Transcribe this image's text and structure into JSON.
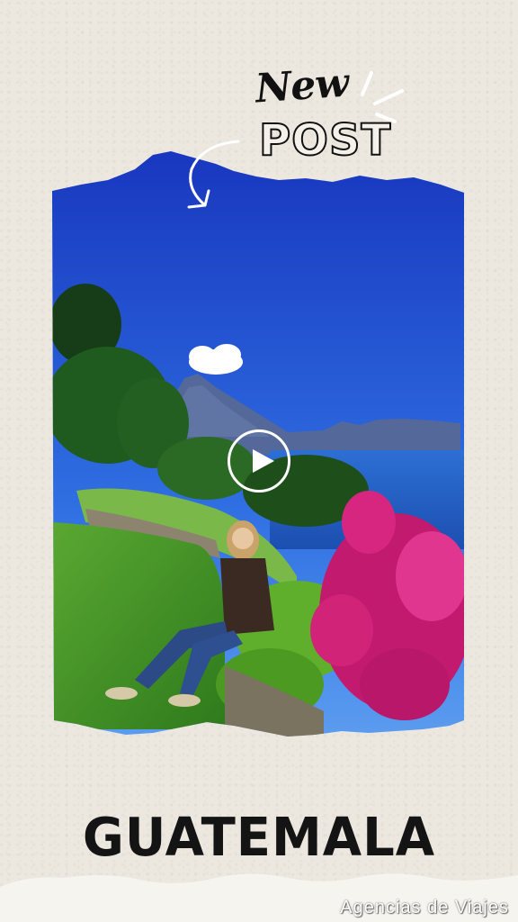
{
  "badge": {
    "new_label": "New",
    "post_label": "POST"
  },
  "media": {
    "play_label": "Play video"
  },
  "caption": {
    "title": "GUATEMALA"
  },
  "watermark": {
    "text": "Agencias de Viajes"
  },
  "colors": {
    "paper": "#ece8df",
    "sky_top": "#1c3fc4",
    "sky_bottom": "#3b7be8",
    "lake": "#2a6fd6",
    "grass": "#4a9a2a",
    "bougainvillea": "#d4247a",
    "ink": "#111111"
  }
}
